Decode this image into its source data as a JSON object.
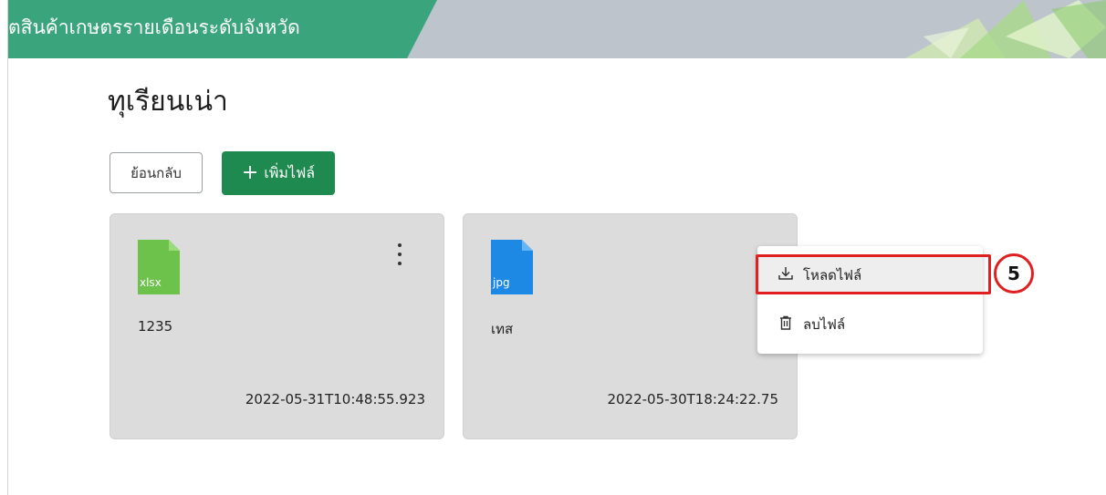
{
  "header": {
    "title": "ิตสินค้าเกษตรรายเดือนระดับจังหวัด"
  },
  "page": {
    "title": "ทุเรียนเน่า"
  },
  "toolbar": {
    "back_label": "ย้อนกลับ",
    "add_label": "เพิ่มไฟล์",
    "add_icon": "plus-icon"
  },
  "files": [
    {
      "name": "1235",
      "ext": "xlsx",
      "date": "2022-05-31T10:48:55.923",
      "icon_color": "#6cc24a"
    },
    {
      "name": "เทส",
      "ext": "jpg",
      "date": "2022-05-30T18:24:22.75",
      "icon_color": "#1e88e5"
    }
  ],
  "context_menu": {
    "download_label": "โหลดไฟล์",
    "delete_label": "ลบไฟล์"
  },
  "annotation": {
    "step": "5",
    "color": "#e02020"
  },
  "colors": {
    "banner_green": "#3aa57c",
    "primary_button": "#1e8a4f"
  }
}
